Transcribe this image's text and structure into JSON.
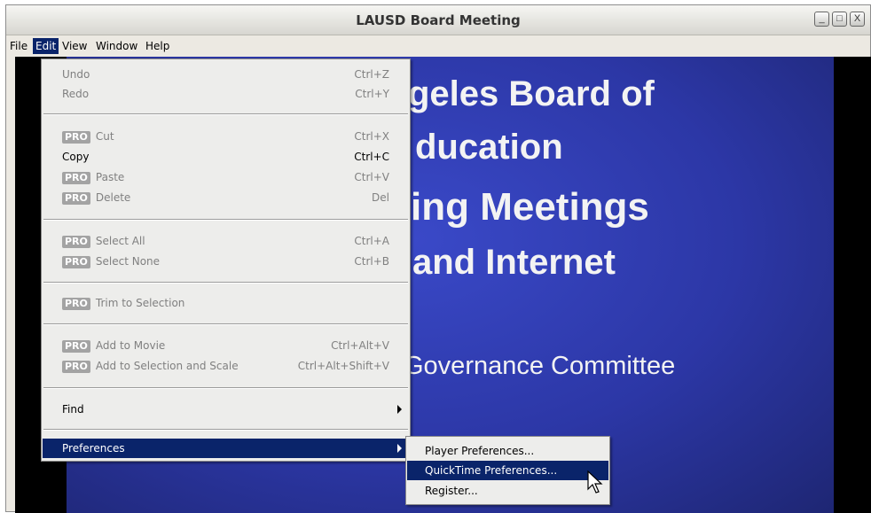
{
  "window": {
    "title": "LAUSD Board Meeting",
    "controls": {
      "minimize": "_",
      "maximize": "□",
      "close": "X"
    }
  },
  "menubar": {
    "items": [
      "File",
      "Edit",
      "View",
      "Window",
      "Help"
    ],
    "active": "Edit"
  },
  "edit_menu": {
    "pro_badge": "PRO",
    "items": [
      {
        "label": "Undo",
        "shortcut": "Ctrl+Z",
        "enabled": false,
        "pro": false
      },
      {
        "label": "Redo",
        "shortcut": "Ctrl+Y",
        "enabled": false,
        "pro": false
      },
      {
        "label": "Cut",
        "shortcut": "Ctrl+X",
        "enabled": false,
        "pro": true
      },
      {
        "label": "Copy",
        "shortcut": "Ctrl+C",
        "enabled": true,
        "pro": false
      },
      {
        "label": "Paste",
        "shortcut": "Ctrl+V",
        "enabled": false,
        "pro": true
      },
      {
        "label": "Delete",
        "shortcut": "Del",
        "enabled": false,
        "pro": true
      },
      {
        "label": "Select All",
        "shortcut": "Ctrl+A",
        "enabled": false,
        "pro": true
      },
      {
        "label": "Select None",
        "shortcut": "Ctrl+B",
        "enabled": false,
        "pro": true
      },
      {
        "label": "Trim to Selection",
        "shortcut": "",
        "enabled": false,
        "pro": true
      },
      {
        "label": "Add to Movie",
        "shortcut": "Ctrl+Alt+V",
        "enabled": false,
        "pro": true
      },
      {
        "label": "Add to Selection and Scale",
        "shortcut": "Ctrl+Alt+Shift+V",
        "enabled": false,
        "pro": true
      },
      {
        "label": "Find",
        "shortcut": "",
        "enabled": true,
        "pro": false
      },
      {
        "label": "Preferences",
        "shortcut": "",
        "enabled": true,
        "pro": false
      }
    ]
  },
  "preferences_submenu": {
    "items": [
      "Player Preferences...",
      "QuickTime Preferences...",
      "Register..."
    ],
    "highlighted": "QuickTime Preferences..."
  },
  "video": {
    "slide_lines": [
      "geles Board of",
      "ducation",
      "ing Meetings",
      "and Internet",
      "Governance Committee"
    ]
  },
  "colors": {
    "highlight": "#0a246a",
    "slide_blue": "#2c37a6",
    "disabled_text": "#808080"
  }
}
